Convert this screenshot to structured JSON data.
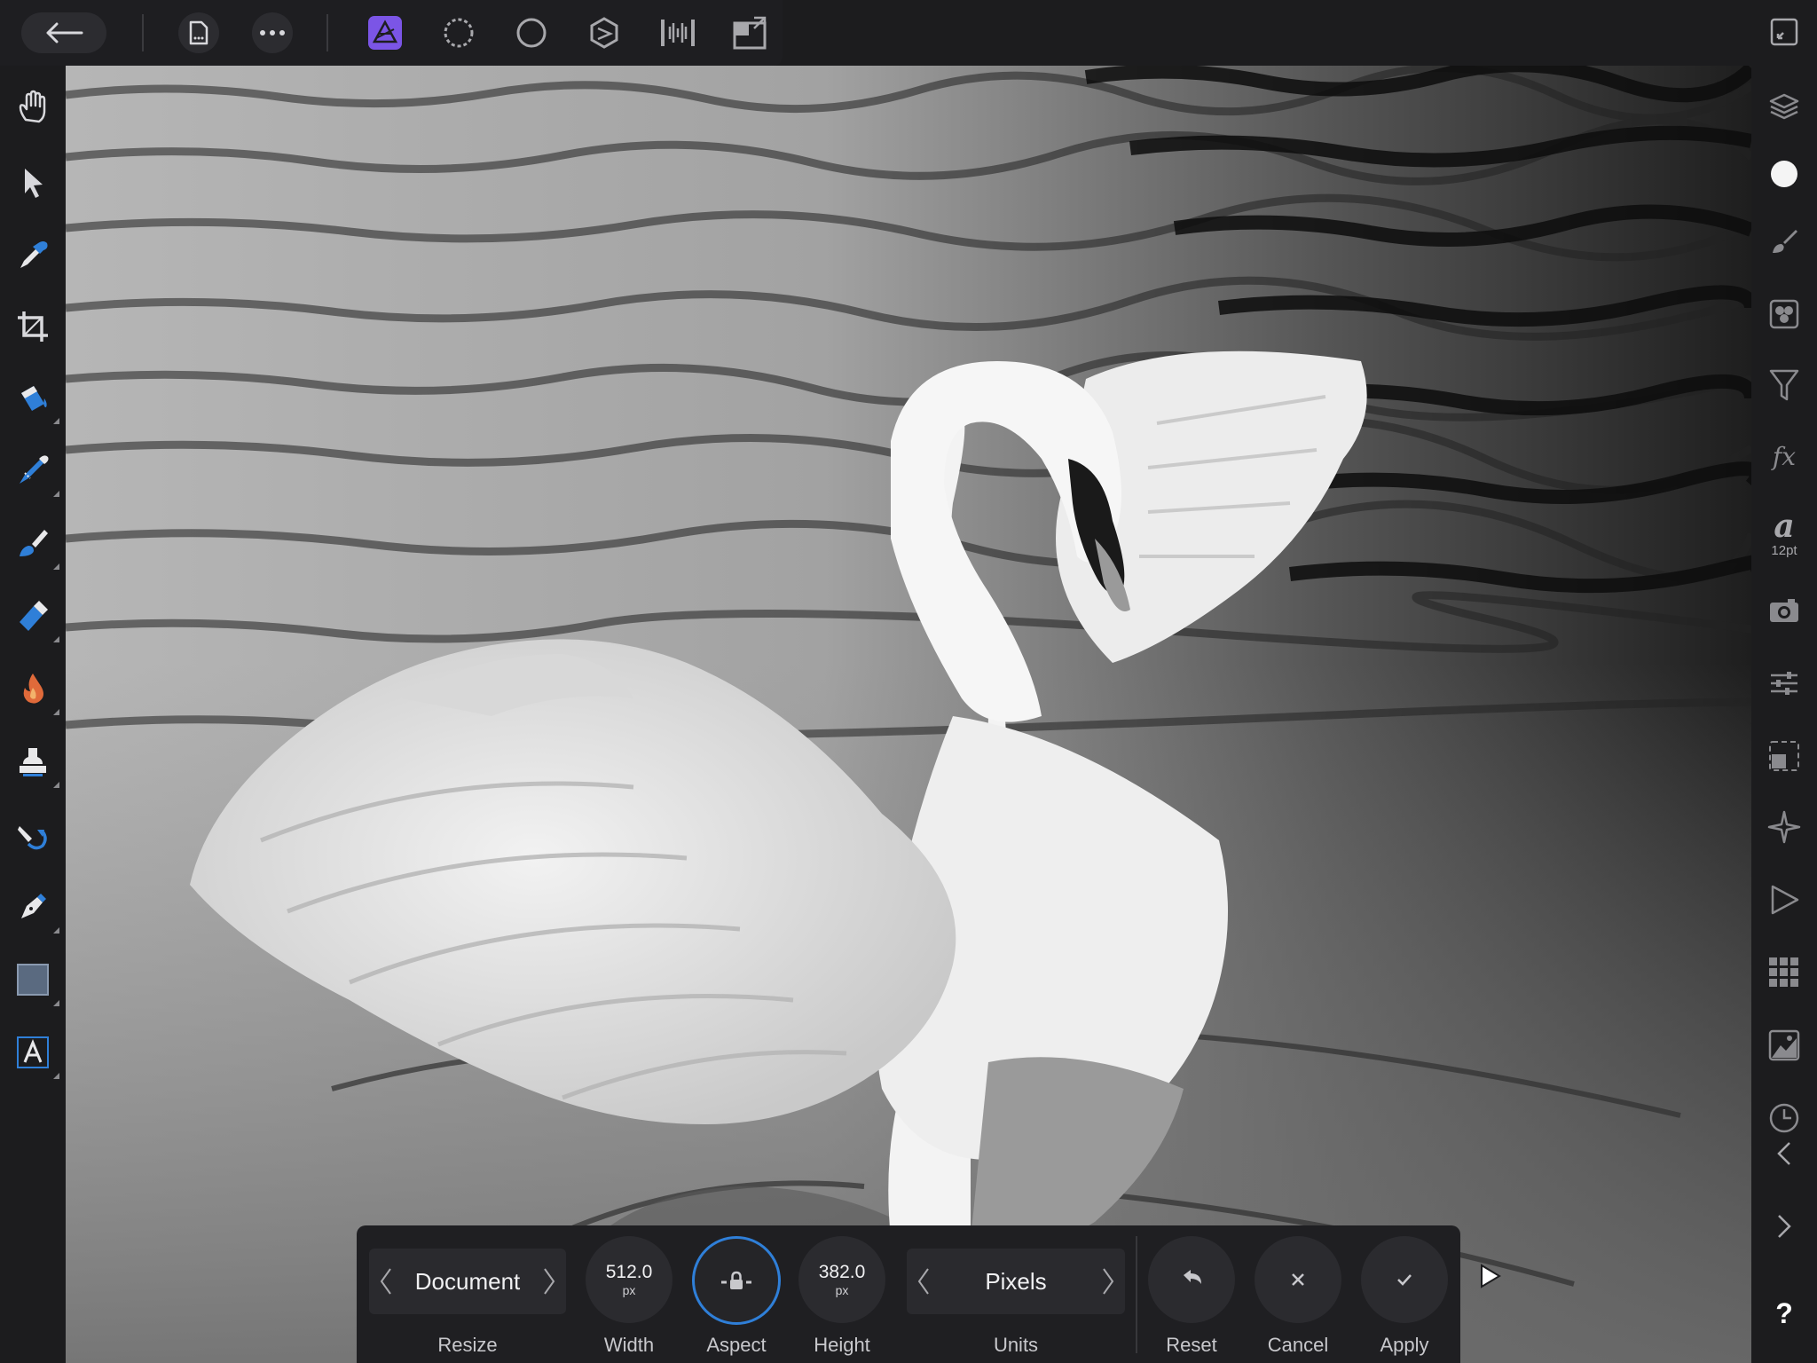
{
  "toolbar": {
    "back_icon": "back-arrow-icon",
    "document_icon": "document-icon",
    "more_icon": "more-icon",
    "personas": [
      "photo-persona-icon",
      "liquify-persona-icon",
      "develop-persona-icon",
      "tone-mapping-persona-icon",
      "export-persona-icon",
      "document-setup-icon"
    ],
    "active_persona_color": "#7b55e6"
  },
  "tools": [
    "hand-tool-icon",
    "move-tool-icon",
    "color-picker-tool-icon",
    "crop-tool-icon",
    "flood-fill-tool-icon",
    "selection-brush-tool-icon",
    "paint-brush-tool-icon",
    "erase-brush-tool-icon",
    "burn-brush-tool-icon",
    "clone-brush-tool-icon",
    "undo-brush-tool-icon",
    "pen-tool-icon",
    "rectangle-tool-icon",
    "artistic-text-tool-icon"
  ],
  "studio": {
    "items": [
      "fullscreen-icon",
      "layers-icon",
      "color-icon",
      "brushes-icon",
      "channels-icon",
      "adjustments-icon",
      "effects-icon",
      "text-styles-icon",
      "stock-icon",
      "transform-icon",
      "navigator-icon",
      "snapping-icon",
      "macros-icon",
      "swatches-icon",
      "histogram-icon",
      "history-icon",
      "collapse-left-icon",
      "expand-right-icon",
      "help-icon"
    ],
    "text_size": "12pt",
    "fx_label": "fx",
    "help_label": "?"
  },
  "context": {
    "resize": {
      "value": "Document",
      "label": "Resize"
    },
    "width": {
      "value": "512.0",
      "unit": "px",
      "label": "Width"
    },
    "aspect": {
      "label": "Aspect",
      "accent": "#2f7fd8"
    },
    "height": {
      "value": "382.0",
      "unit": "px",
      "label": "Height"
    },
    "units": {
      "value": "Pixels",
      "label": "Units"
    },
    "reset": {
      "label": "Reset"
    },
    "cancel": {
      "label": "Cancel"
    },
    "apply": {
      "label": "Apply"
    }
  }
}
